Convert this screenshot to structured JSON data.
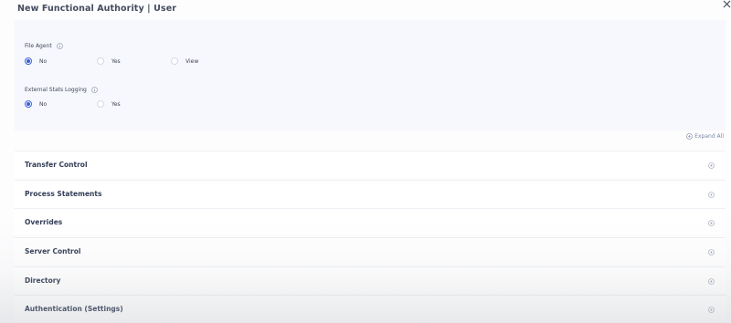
{
  "modal": {
    "title": "New Functional Authority | User",
    "close_icon": "close-icon"
  },
  "fields": [
    {
      "label": "File Agent",
      "icon": "info-icon",
      "options": [
        "No",
        "Yes",
        "View"
      ],
      "selected": "No"
    },
    {
      "label": "External Stats Logging",
      "icon": "info-icon",
      "options": [
        "No",
        "Yes"
      ],
      "selected": "No"
    }
  ],
  "expand_all": {
    "label": "Expand All",
    "icon": "plus-circle-icon"
  },
  "sections": [
    {
      "title": "Transfer Control",
      "icon": "plus-circle-icon"
    },
    {
      "title": "Process Statements",
      "icon": "plus-circle-icon"
    },
    {
      "title": "Overrides",
      "icon": "plus-circle-icon"
    },
    {
      "title": "Server Control",
      "icon": "plus-circle-icon"
    },
    {
      "title": "Directory",
      "icon": "plus-circle-icon"
    },
    {
      "title": "Authentication (Settings)",
      "icon": "plus-circle-icon"
    }
  ],
  "colors": {
    "accent": "#3f62d9",
    "panel_background": "#f7f8fd",
    "section_title": "#323d56"
  }
}
